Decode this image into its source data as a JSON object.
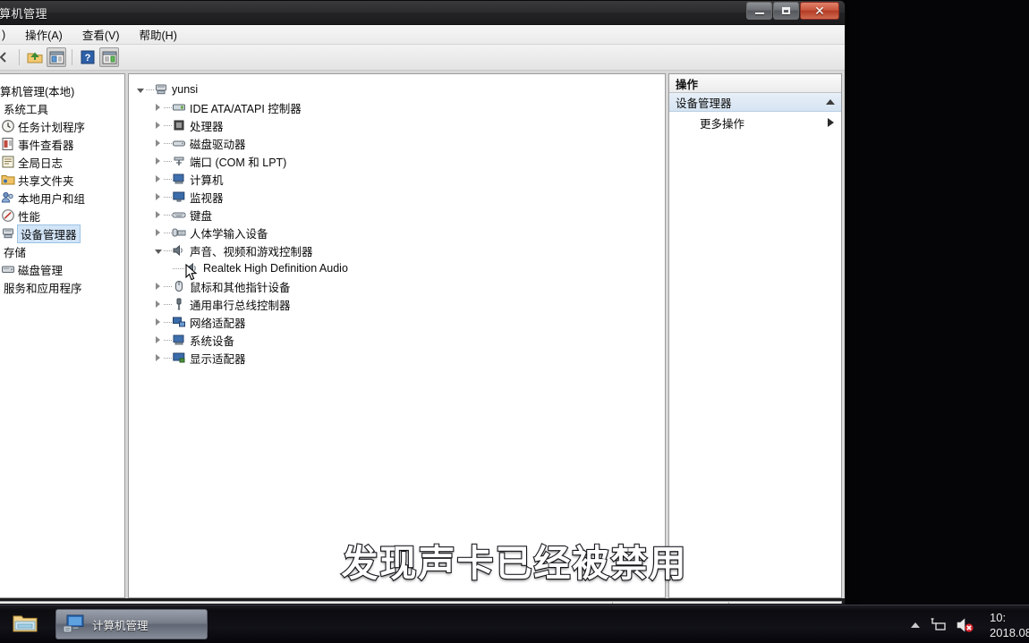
{
  "window": {
    "title": "算机管理",
    "buttons": {
      "minimize": "minimize-icon",
      "maximize": "maximize-icon",
      "close": "✕"
    }
  },
  "menubar": {
    "items": [
      {
        "label": ")"
      },
      {
        "label": "操作(A)"
      },
      {
        "label": "查看(V)"
      },
      {
        "label": "帮助(H)"
      }
    ]
  },
  "toolbar": {
    "buttons": [
      {
        "name": "back-arrow-icon"
      },
      {
        "name": "up-folder-icon"
      },
      {
        "name": "show-hide-tree-icon"
      },
      {
        "name": "help-icon",
        "label": "?"
      },
      {
        "name": "show-hide-action-pane-icon"
      }
    ]
  },
  "console_tree": {
    "items": [
      {
        "label": "算机管理(本地)",
        "icon": "computer-icon",
        "level": 0,
        "selected": false
      },
      {
        "label": "系统工具",
        "icon": "none",
        "level": 1,
        "selected": false
      },
      {
        "label": "任务计划程序",
        "icon": "clock-icon",
        "level": 2,
        "selected": false
      },
      {
        "label": "事件查看器",
        "icon": "event-log-icon",
        "level": 2,
        "selected": false
      },
      {
        "label": "全局日志",
        "icon": "journal-icon",
        "level": 2,
        "selected": false
      },
      {
        "label": "共享文件夹",
        "icon": "shared-folder-icon",
        "level": 2,
        "selected": false
      },
      {
        "label": "本地用户和组",
        "icon": "users-icon",
        "level": 2,
        "selected": false
      },
      {
        "label": "性能",
        "icon": "performance-icon",
        "level": 2,
        "selected": false
      },
      {
        "label": "设备管理器",
        "icon": "device-manager-icon",
        "level": 2,
        "selected": true
      },
      {
        "label": "存储",
        "icon": "none",
        "level": 1,
        "selected": false
      },
      {
        "label": "磁盘管理",
        "icon": "disk-management-icon",
        "level": 2,
        "selected": false
      },
      {
        "label": "服务和应用程序",
        "icon": "none",
        "level": 1,
        "selected": false
      }
    ]
  },
  "device_tree": {
    "root": {
      "label": "yunsi",
      "icon": "computer-root-icon",
      "expanded": true
    },
    "nodes": [
      {
        "label": "IDE ATA/ATAPI 控制器",
        "icon": "ide-controller-icon",
        "expanded": false,
        "level": 1
      },
      {
        "label": "处理器",
        "icon": "processor-icon",
        "expanded": false,
        "level": 1
      },
      {
        "label": "磁盘驱动器",
        "icon": "disk-drive-icon",
        "expanded": false,
        "level": 1
      },
      {
        "label": "端口 (COM 和 LPT)",
        "icon": "port-icon",
        "expanded": false,
        "level": 1
      },
      {
        "label": "计算机",
        "icon": "computer-node-icon",
        "expanded": false,
        "level": 1
      },
      {
        "label": "监视器",
        "icon": "monitor-icon",
        "expanded": false,
        "level": 1
      },
      {
        "label": "键盘",
        "icon": "keyboard-icon",
        "expanded": false,
        "level": 1
      },
      {
        "label": "人体学输入设备",
        "icon": "hid-icon",
        "expanded": false,
        "level": 1
      },
      {
        "label": "声音、视频和游戏控制器",
        "icon": "sound-controller-icon",
        "expanded": true,
        "level": 1
      },
      {
        "label": "Realtek High Definition Audio",
        "icon": "audio-device-disabled-icon",
        "expanded": null,
        "level": 2
      },
      {
        "label": "鼠标和其他指针设备",
        "icon": "mouse-icon",
        "expanded": false,
        "level": 1
      },
      {
        "label": "通用串行总线控制器",
        "icon": "usb-controller-icon",
        "expanded": false,
        "level": 1
      },
      {
        "label": "网络适配器",
        "icon": "network-adapter-icon",
        "expanded": false,
        "level": 1
      },
      {
        "label": "系统设备",
        "icon": "system-device-icon",
        "expanded": false,
        "level": 1
      },
      {
        "label": "显示适配器",
        "icon": "display-adapter-icon",
        "expanded": false,
        "level": 1
      }
    ]
  },
  "actions_pane": {
    "header": "操作",
    "section": "设备管理器",
    "items": [
      {
        "label": "更多操作",
        "submenu": true
      }
    ]
  },
  "subtitle": {
    "text": "发现声卡已经被禁用"
  },
  "taskbar": {
    "quick_launch": [
      {
        "name": "explorer-folder-icon"
      }
    ],
    "tasks": [
      {
        "label": "计算机管理",
        "icon": "computer-management-icon",
        "active": true
      }
    ],
    "tray": {
      "chevron": "show-hidden-icons-icon",
      "network": "network-icon",
      "volume": "volume-muted-icon",
      "time": "10:",
      "date": "2018.08"
    }
  },
  "colors": {
    "accent": "#d2e4f7",
    "section_bg": "#d6e4f2",
    "close_button": "#c9563c",
    "muted_mark": "#d8232a"
  }
}
